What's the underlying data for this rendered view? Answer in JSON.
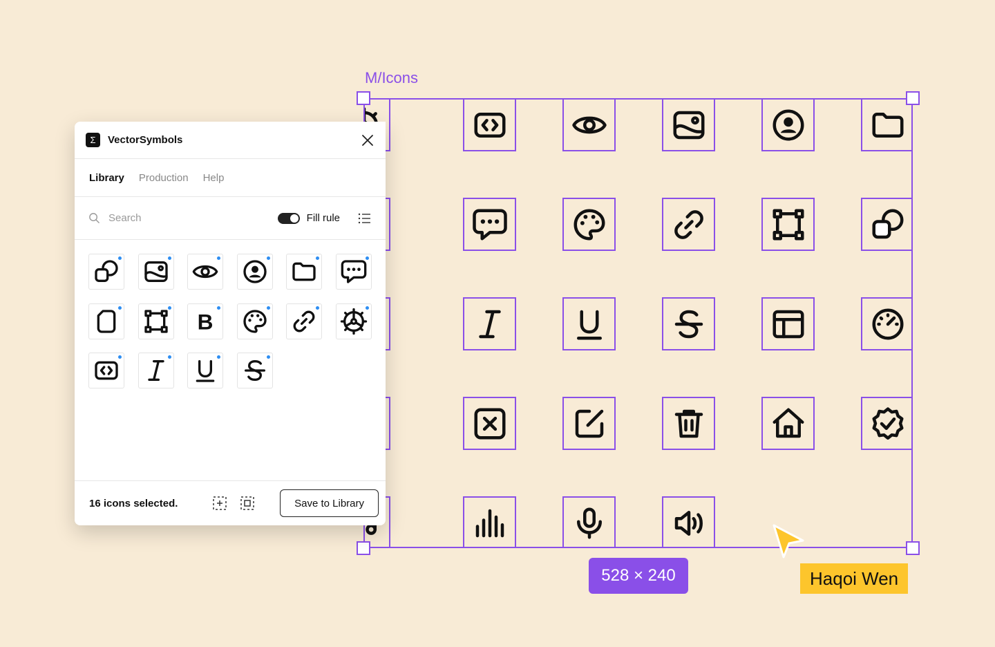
{
  "canvas": {
    "frame_name": "M/Icons",
    "dimensions": "528 × 240",
    "cursor_user": "Haqoi Wen",
    "accent_color": "#8A4FE8",
    "cursor_color": "#FDC52C",
    "background_color": "#F8EBD6",
    "frame_icons": [
      [
        "dashboard-icon",
        "code-icon",
        "eye-icon",
        "image-icon",
        "user-circle-icon",
        "folder-icon"
      ],
      [
        "file-icon",
        "chat-icon",
        "palette-icon",
        "link-icon",
        "frame-icon",
        "shapes-icon"
      ],
      [
        "bold-icon",
        "italic-icon",
        "underline-icon",
        "strikethrough-icon",
        "layout-icon",
        "gauge-icon"
      ],
      [
        "checkbox-icon",
        "close-box-icon",
        "edit-icon",
        "trash-icon",
        "home-icon",
        "verified-icon"
      ],
      [
        "music-icon",
        "equalizer-icon",
        "microphone-icon",
        "volume-icon"
      ]
    ]
  },
  "panel": {
    "app_name": "VectorSymbols",
    "logo_glyph": "Σ",
    "tabs": [
      "Library",
      "Production",
      "Help"
    ],
    "active_tab": "Library",
    "search_placeholder": "Search",
    "fill_rule_label": "Fill rule",
    "fill_rule_on": true,
    "icons": [
      "shapes-icon",
      "image-icon",
      "eye-icon",
      "user-circle-icon",
      "folder-icon",
      "chat-icon",
      "file-icon",
      "frame-icon",
      "bold-icon",
      "palette-icon",
      "link-icon",
      "dashboard-icon",
      "code-icon",
      "italic-icon",
      "underline-icon",
      "strikethrough-icon"
    ],
    "selection_text": "16 icons selected.",
    "save_button": "Save to Library"
  }
}
